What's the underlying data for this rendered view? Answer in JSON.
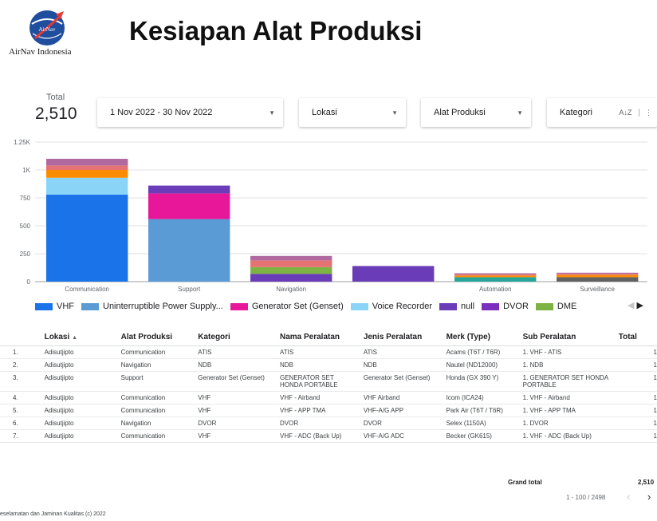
{
  "brand": {
    "logo_text": "AirNav Indonesia",
    "logo_inner": "AirNav"
  },
  "page_title": "Kesiapan Alat Produksi",
  "scorecard": {
    "label": "Total",
    "value": "2,510"
  },
  "filters": {
    "date_range": "1 Nov 2022 - 30 Nov 2022",
    "lokasi": "Lokasi",
    "alat_produksi": "Alat Produksi",
    "kategori": "Kategori",
    "sort_icon": "A↓Z"
  },
  "colors": {
    "VHF": "#1a73e8",
    "UPS": "#5b9bd5",
    "Generator": "#e8179a",
    "VoiceRecorder": "#8ad4f8",
    "null": "#6a3cb8",
    "DVOR": "#7b2fbe",
    "DME": "#7cb342",
    "Orange": "#fb8c00",
    "Pink": "#e57373",
    "Mauve": "#b06aa0",
    "Teal": "#26a69a",
    "Brown": "#8d6e63",
    "Grey": "#616161"
  },
  "chart_data": {
    "type": "bar",
    "stacked": true,
    "categories": [
      "Communication",
      "Support",
      "Navigation",
      "",
      "Automation",
      "Surveillance"
    ],
    "y_ticks": [
      "0",
      "250",
      "500",
      "750",
      "1K",
      "1.25K"
    ],
    "ylim": [
      0,
      1250
    ],
    "grid": true,
    "legend_position": "bottom",
    "series": [
      {
        "name": "VHF",
        "color_key": "VHF",
        "values": [
          780,
          0,
          0,
          0,
          0,
          0
        ]
      },
      {
        "name": "Uninterruptible Power Supply...",
        "color_key": "UPS",
        "values": [
          0,
          560,
          0,
          0,
          0,
          0
        ]
      },
      {
        "name": "Generator Set (Genset)",
        "color_key": "Generator",
        "values": [
          0,
          230,
          0,
          0,
          0,
          0
        ]
      },
      {
        "name": "Voice Recorder",
        "color_key": "VoiceRecorder",
        "values": [
          150,
          0,
          0,
          0,
          0,
          0
        ]
      },
      {
        "name": "null",
        "color_key": "null",
        "values": [
          0,
          70,
          70,
          140,
          0,
          0
        ]
      },
      {
        "name": "DVOR",
        "color_key": "DVOR",
        "values": [
          0,
          0,
          0,
          0,
          0,
          0
        ]
      },
      {
        "name": "DME",
        "color_key": "DME",
        "values": [
          0,
          0,
          60,
          0,
          0,
          0
        ]
      },
      {
        "name": "",
        "color_key": "Teal",
        "values": [
          0,
          0,
          0,
          0,
          40,
          0
        ]
      },
      {
        "name": "",
        "color_key": "Grey",
        "values": [
          0,
          0,
          0,
          0,
          0,
          40
        ]
      },
      {
        "name": "",
        "color_key": "Orange",
        "values": [
          70,
          0,
          0,
          0,
          15,
          20
        ]
      },
      {
        "name": "",
        "color_key": "Pink",
        "values": [
          40,
          0,
          60,
          0,
          10,
          10
        ]
      },
      {
        "name": "",
        "color_key": "Mauve",
        "values": [
          60,
          0,
          40,
          0,
          10,
          10
        ]
      }
    ]
  },
  "legend_nav": {
    "prev": "◀",
    "next": "▶"
  },
  "table": {
    "headers": [
      "",
      "Lokasi",
      "Alat Produksi",
      "Kategori",
      "Nama Peralatan",
      "Jenis Peralatan",
      "Merk (Type)",
      "Sub Peralatan",
      "Total"
    ],
    "sort_indicator": "▲",
    "rows": [
      [
        "1.",
        "Adisutjipto",
        "Communication",
        "ATIS",
        "ATIS",
        "ATIS",
        "Acams (T6T / T6R)",
        "1. VHF - ATIS",
        "1"
      ],
      [
        "2.",
        "Adisutjipto",
        "Navigation",
        "NDB",
        "NDB",
        "NDB",
        "Nautel (ND12000)",
        "1. NDB",
        "1"
      ],
      [
        "3.",
        "Adisutjipto",
        "Support",
        "Generator Set (Genset)",
        "GENERATOR SET HONDA PORTABLE",
        "Generator Set (Genset)",
        "Honda (GX 390 Y)",
        "1. GENERATOR SET HONDA PORTABLE",
        "1"
      ],
      [
        "4.",
        "Adisutjipto",
        "Communication",
        "VHF",
        "VHF - Airband",
        "VHF Airband",
        "Icom (ICA24)",
        "1. VHF - Airband",
        "1"
      ],
      [
        "5.",
        "Adisutjipto",
        "Communication",
        "VHF",
        "VHF - APP TMA",
        "VHF-A/G APP",
        "Park Air (T6T / T6R)",
        "1. VHF - APP TMA",
        "1"
      ],
      [
        "6.",
        "Adisutjipto",
        "Navigation",
        "DVOR",
        "DVOR",
        "DVOR",
        "Selex (1150A)",
        "1. DVOR",
        "1"
      ],
      [
        "7.",
        "Adisutjipto",
        "Communication",
        "VHF",
        "VHF - ADC (Back Up)",
        "VHF-A/G ADC",
        "Becker (GK615)",
        "1. VHF - ADC (Back Up)",
        "1"
      ]
    ],
    "grand_total_label": "Grand total",
    "grand_total_value": "2,510",
    "pager": "1 - 100 / 2498",
    "pager_prev": "‹",
    "pager_next": "›"
  },
  "footer": "eselamatan dan Jaminan Kualitas (c) 2022"
}
